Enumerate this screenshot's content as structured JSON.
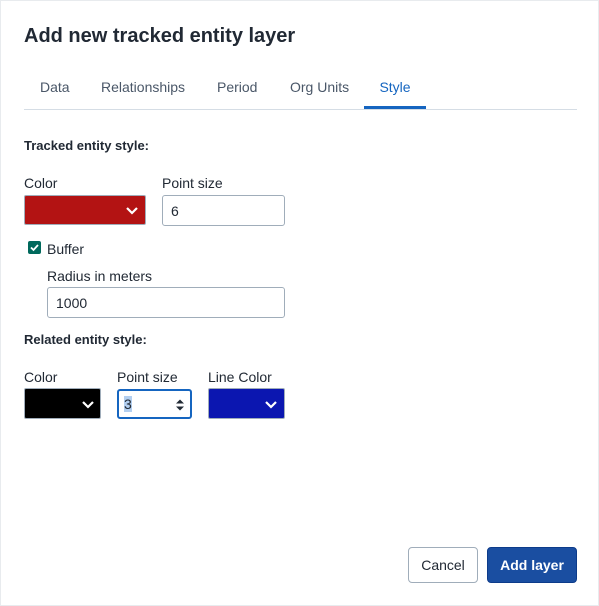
{
  "dialog": {
    "title": "Add new tracked entity layer"
  },
  "tabs": [
    {
      "label": "Data"
    },
    {
      "label": "Relationships"
    },
    {
      "label": "Period"
    },
    {
      "label": "Org Units"
    },
    {
      "label": "Style",
      "active": true
    }
  ],
  "tracked_style": {
    "heading": "Tracked entity style:",
    "color_label": "Color",
    "color_value": "#b31313",
    "point_size_label": "Point size",
    "point_size_value": "6",
    "buffer_label": "Buffer",
    "buffer_checked": true,
    "radius_label": "Radius in meters",
    "radius_value": "1000"
  },
  "related_style": {
    "heading": "Related entity style:",
    "color_label": "Color",
    "color_value": "#000000",
    "point_size_label": "Point size",
    "point_size_value": "3",
    "line_color_label": "Line Color",
    "line_color_value": "#0b16b0"
  },
  "footer": {
    "cancel_label": "Cancel",
    "add_label": "Add layer"
  },
  "icons": [
    "chevron-down-icon",
    "check-icon",
    "stepper-icon"
  ],
  "colors": {
    "accent": "#1565c0",
    "primary_button": "#1a4ea1",
    "checkbox": "#00695c"
  }
}
